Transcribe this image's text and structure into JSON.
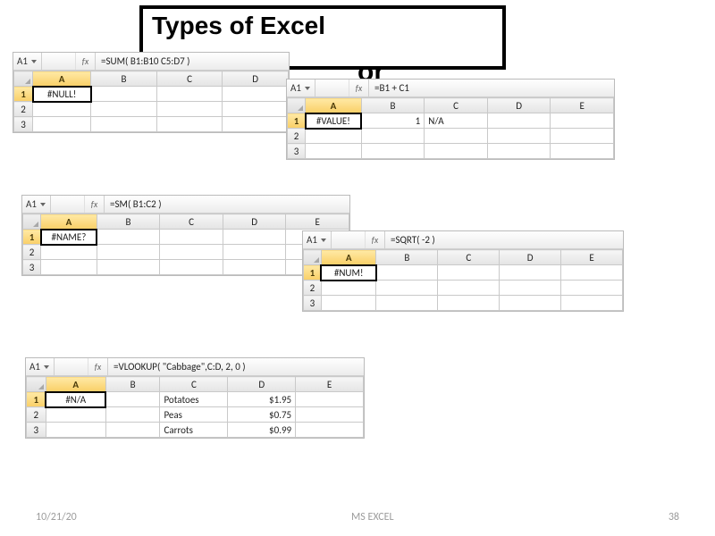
{
  "title": "Types of Excel",
  "title_or": "or",
  "footer": {
    "date": "10/21/20",
    "label": "MS EXCEL",
    "page": "38"
  },
  "snips": {
    "s1": {
      "cell_ref": "A1",
      "formula": "=SUM( B1:B10 C5:D7 )",
      "cols": [
        "A",
        "B",
        "C",
        "D"
      ],
      "rows": [
        {
          "n": 1,
          "a": "#NULL!",
          "b": "",
          "c": "",
          "d": ""
        },
        {
          "n": 2
        },
        {
          "n": 3
        }
      ]
    },
    "s2": {
      "cell_ref": "A1",
      "formula": "=B1 + C1",
      "cols": [
        "A",
        "B",
        "C",
        "D",
        "E"
      ],
      "rows": [
        {
          "n": 1,
          "a": "#VALUE!",
          "b": "1",
          "c": "N/A",
          "d": "",
          "e": ""
        },
        {
          "n": 2
        },
        {
          "n": 3
        }
      ]
    },
    "s3": {
      "cell_ref": "A1",
      "formula": "=SM( B1:C2 )",
      "cols": [
        "A",
        "B",
        "C",
        "D",
        "E"
      ],
      "rows": [
        {
          "n": 1,
          "a": "#NAME?",
          "b": "",
          "c": "",
          "d": "",
          "e": ""
        },
        {
          "n": 2
        },
        {
          "n": 3
        }
      ]
    },
    "s4": {
      "cell_ref": "A1",
      "formula": "=SQRT( -2 )",
      "cols": [
        "A",
        "B",
        "C",
        "D",
        "E"
      ],
      "rows": [
        {
          "n": 1,
          "a": "#NUM!",
          "b": "",
          "c": "",
          "d": "",
          "e": ""
        },
        {
          "n": 2
        },
        {
          "n": 3
        }
      ]
    },
    "s5": {
      "cell_ref": "A1",
      "formula": "=VLOOKUP( \"Cabbage\",C:D, 2, 0 )",
      "cols": [
        "A",
        "B",
        "C",
        "D",
        "E"
      ],
      "rows": [
        {
          "n": 1,
          "a": "#N/A",
          "b": "",
          "c": "Potatoes",
          "d": "$1.95",
          "e": ""
        },
        {
          "n": 2,
          "a": "",
          "b": "",
          "c": "Peas",
          "d": "$0.75",
          "e": ""
        },
        {
          "n": 3,
          "a": "",
          "b": "",
          "c": "Carrots",
          "d": "$0.99",
          "e": ""
        }
      ]
    }
  }
}
